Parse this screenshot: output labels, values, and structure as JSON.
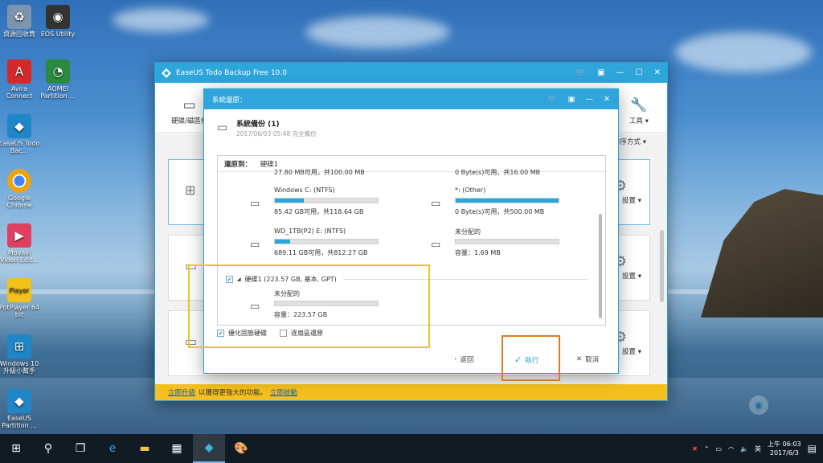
{
  "desktop": {
    "icons": [
      {
        "label": "資源回收筒",
        "icon": "recycle-bin-icon",
        "color": "#6b86a3"
      },
      {
        "label": "EOS Utility",
        "icon": "camera-icon",
        "color": "#333333"
      },
      {
        "label": "Avira Connect",
        "icon": "avira-icon",
        "color": "#d62828"
      },
      {
        "label": "AOMEI Partition ...",
        "icon": "aomei-icon",
        "color": "#2b8a3e"
      },
      {
        "label": "EaseUS Todo Bac...",
        "icon": "easeus-icon",
        "color": "#1f86c8"
      },
      {
        "label": "Google Chrome",
        "icon": "chrome-icon",
        "color": "#e8a317"
      },
      {
        "label": "Movavi Video Edit...",
        "icon": "movavi-icon",
        "color": "#e04060"
      },
      {
        "label": "PotPlayer 64 bit",
        "icon": "potplayer-icon",
        "color": "#f2c11b"
      },
      {
        "label": "Windows 10 升級小幫手",
        "icon": "windows-icon",
        "color": "#1f86c8"
      },
      {
        "label": "EaseUS Partition ...",
        "icon": "easeus-partition-icon",
        "color": "#1f86c8"
      }
    ]
  },
  "app": {
    "title": "EaseUS Todo Backup Free 10.0",
    "toolbar": {
      "disk_backup_label": "硬碟/磁區備",
      "tools_label": "工具"
    },
    "sort_label": "排序方式",
    "card_settings_label": "設置",
    "footer": {
      "upgrade_link": "立即升級",
      "middle_text": "以獲得更強大的功能。",
      "activate_link": "立即啟動"
    }
  },
  "dialog": {
    "title": "系統還原：",
    "backup_name": "系統備份 (1)",
    "backup_date": "2017/06/03 05:48 完全備份",
    "restore_to_label": "還原到：",
    "restore_to_value": "硬碟1",
    "top_left_clipped": "27.80 MB可用，共100.00 MB",
    "top_right_clipped": "0 Byte(s)可用，共16.00 MB",
    "partitions": [
      {
        "name": "Windows C: (NTFS)",
        "info": "85.42 GB可用，共118.64 GB",
        "fill": 0.28
      },
      {
        "name": "*: (Other)",
        "info": "0 Byte(s)可用，共500.00 MB",
        "fill": 1.0
      },
      {
        "name": "WD_1TB(P2) E: (NTFS)",
        "info": "689.11 GB可用，共812.27 GB",
        "fill": 0.15
      },
      {
        "name": "未分配的",
        "info": "容量：1.69 MB",
        "fill": 0.0
      },
      {
        "name": "未分配的",
        "info": "容量：223.57 GB",
        "fill": 0.0
      }
    ],
    "disk1_label": "硬碟1 (223.57 GB, 基本, GPT)",
    "opt_optimize_ssd": "優化固態硬碟",
    "opt_sector_by_sector": "逐扇區還原",
    "back_button": "返回",
    "execute_button": "執行",
    "cancel_button": "取消"
  },
  "taskbar": {
    "time": "上午 06:03",
    "date": "2017/6/3",
    "ime": "英"
  }
}
